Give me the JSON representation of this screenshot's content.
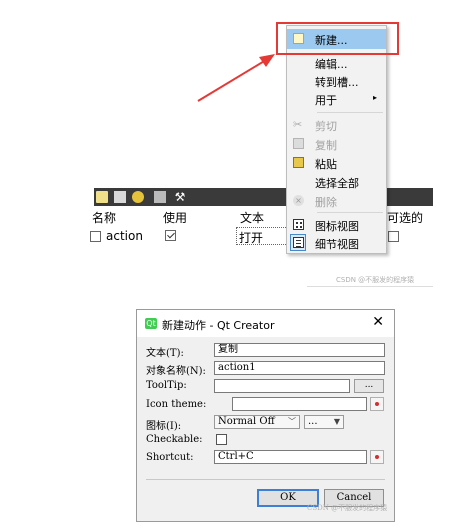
{
  "action_editor": {
    "columns": [
      "名称",
      "使用",
      "文本",
      "可选的"
    ],
    "row": {
      "name": "action",
      "used_checked": true,
      "text": "打开"
    }
  },
  "context_menu": {
    "items": [
      {
        "label": "新建...",
        "icon": "new-document-icon",
        "highlighted": true,
        "disabled": false
      },
      {
        "label": "编辑...",
        "disabled": false
      },
      {
        "label": "转到槽...",
        "disabled": false
      },
      {
        "label": "用于",
        "submenu": true,
        "disabled": false
      },
      {
        "label": "剪切",
        "icon": "scissors-icon",
        "disabled": true
      },
      {
        "label": "复制",
        "icon": "copy-icon",
        "disabled": true
      },
      {
        "label": "粘贴",
        "icon": "paste-icon",
        "disabled": false
      },
      {
        "label": "选择全部",
        "disabled": false
      },
      {
        "label": "删除",
        "icon": "delete-icon",
        "disabled": true
      },
      {
        "label": "图标视图",
        "icon": "icon-view-icon",
        "disabled": false
      },
      {
        "label": "细节视图",
        "icon": "detail-view-icon",
        "checked": true,
        "disabled": false
      }
    ],
    "submenu_arrow": "▸"
  },
  "watermark_top": "CSDN @不服发的程序猿",
  "watermark_bottom": "CSDN @不服发的程序猿",
  "dialog": {
    "title": "新建动作 - Qt Creator",
    "close_glyph": "✕",
    "fields": {
      "text_label": "文本(T):",
      "text_value": "复制",
      "object_name_label": "对象名称(N):",
      "object_name_value": "action1",
      "tooltip_label": "ToolTip:",
      "tooltip_value": "",
      "icon_theme_label": "Icon theme:",
      "icon_theme_value": "",
      "icon_label": "图标(I):",
      "icon_mode": "Normal Off",
      "checkable_label": "Checkable:",
      "checkable_checked": false,
      "shortcut_label": "Shortcut:",
      "shortcut_value": "Ctrl+C"
    },
    "browse_label": "...",
    "ok_label": "OK",
    "cancel_label": "Cancel"
  },
  "colors": {
    "highlight": "#9cc9ef",
    "annotation_red": "#e53935",
    "toolbar_dark": "#3a3a3a",
    "default_button_border": "#3c7fd6"
  }
}
